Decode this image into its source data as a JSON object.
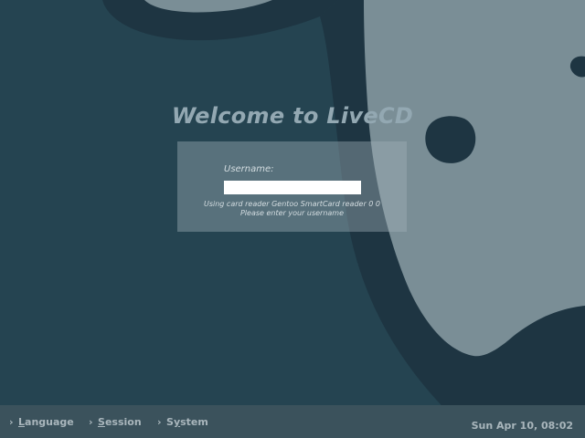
{
  "screen": {
    "title": "Welcome to LiveCD"
  },
  "login": {
    "username_label": "Username:",
    "username_value": "",
    "messages": [
      "Using card reader Gentoo SmartCard reader 0 0",
      "Please enter your username"
    ]
  },
  "bottom_bar": {
    "items": [
      {
        "mnemonic": "L",
        "rest": "anguage",
        "icon": "chevron-right-icon"
      },
      {
        "mnemonic": "S",
        "rest": "ession",
        "icon": "chevron-right-icon"
      },
      {
        "mnemonic_prefix": "S",
        "mnemonic": "y",
        "rest": "stem",
        "icon": "chevron-right-icon"
      }
    ],
    "clock": "Sun Apr 10, 08:02"
  },
  "colors": {
    "background": "#254451",
    "dark_shape": "#1e3542",
    "light_shape": "#7a8e96",
    "title_text": "#93a8b2",
    "bar_background": "#3b525c",
    "bar_text": "#a9b6bc"
  }
}
